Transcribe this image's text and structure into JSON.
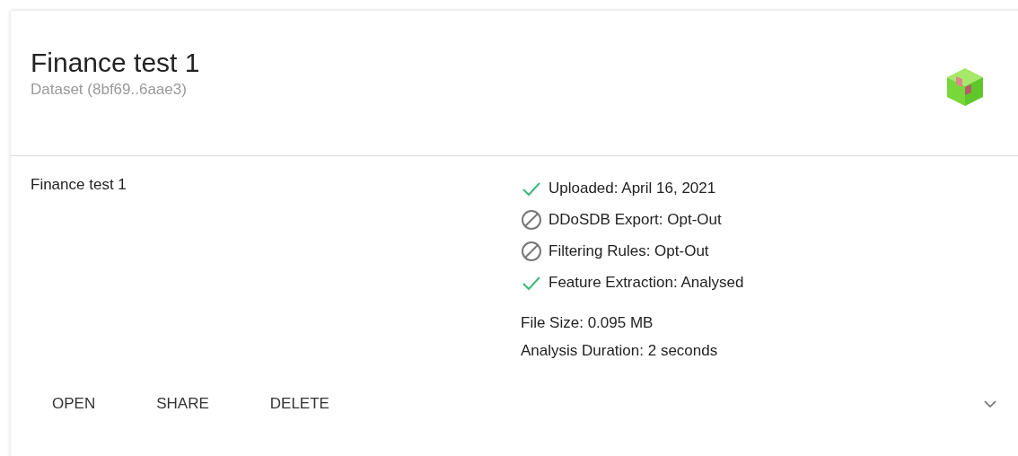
{
  "card": {
    "title": "Finance test 1",
    "subtitle": "Dataset (8bf69..6aae3)",
    "description": "Finance test 1",
    "statuses": [
      {
        "kind": "done",
        "label": "Uploaded: April 16, 2021"
      },
      {
        "kind": "opt_out",
        "label": "DDoSDB Export: Opt-Out"
      },
      {
        "kind": "opt_out",
        "label": "Filtering Rules: Opt-Out"
      },
      {
        "kind": "done",
        "label": "Feature Extraction: Analysed"
      }
    ],
    "details": [
      "File Size: 0.095 MB",
      "Analysis Duration: 2 seconds"
    ],
    "actions": [
      "OPEN",
      "SHARE",
      "DELETE"
    ]
  }
}
